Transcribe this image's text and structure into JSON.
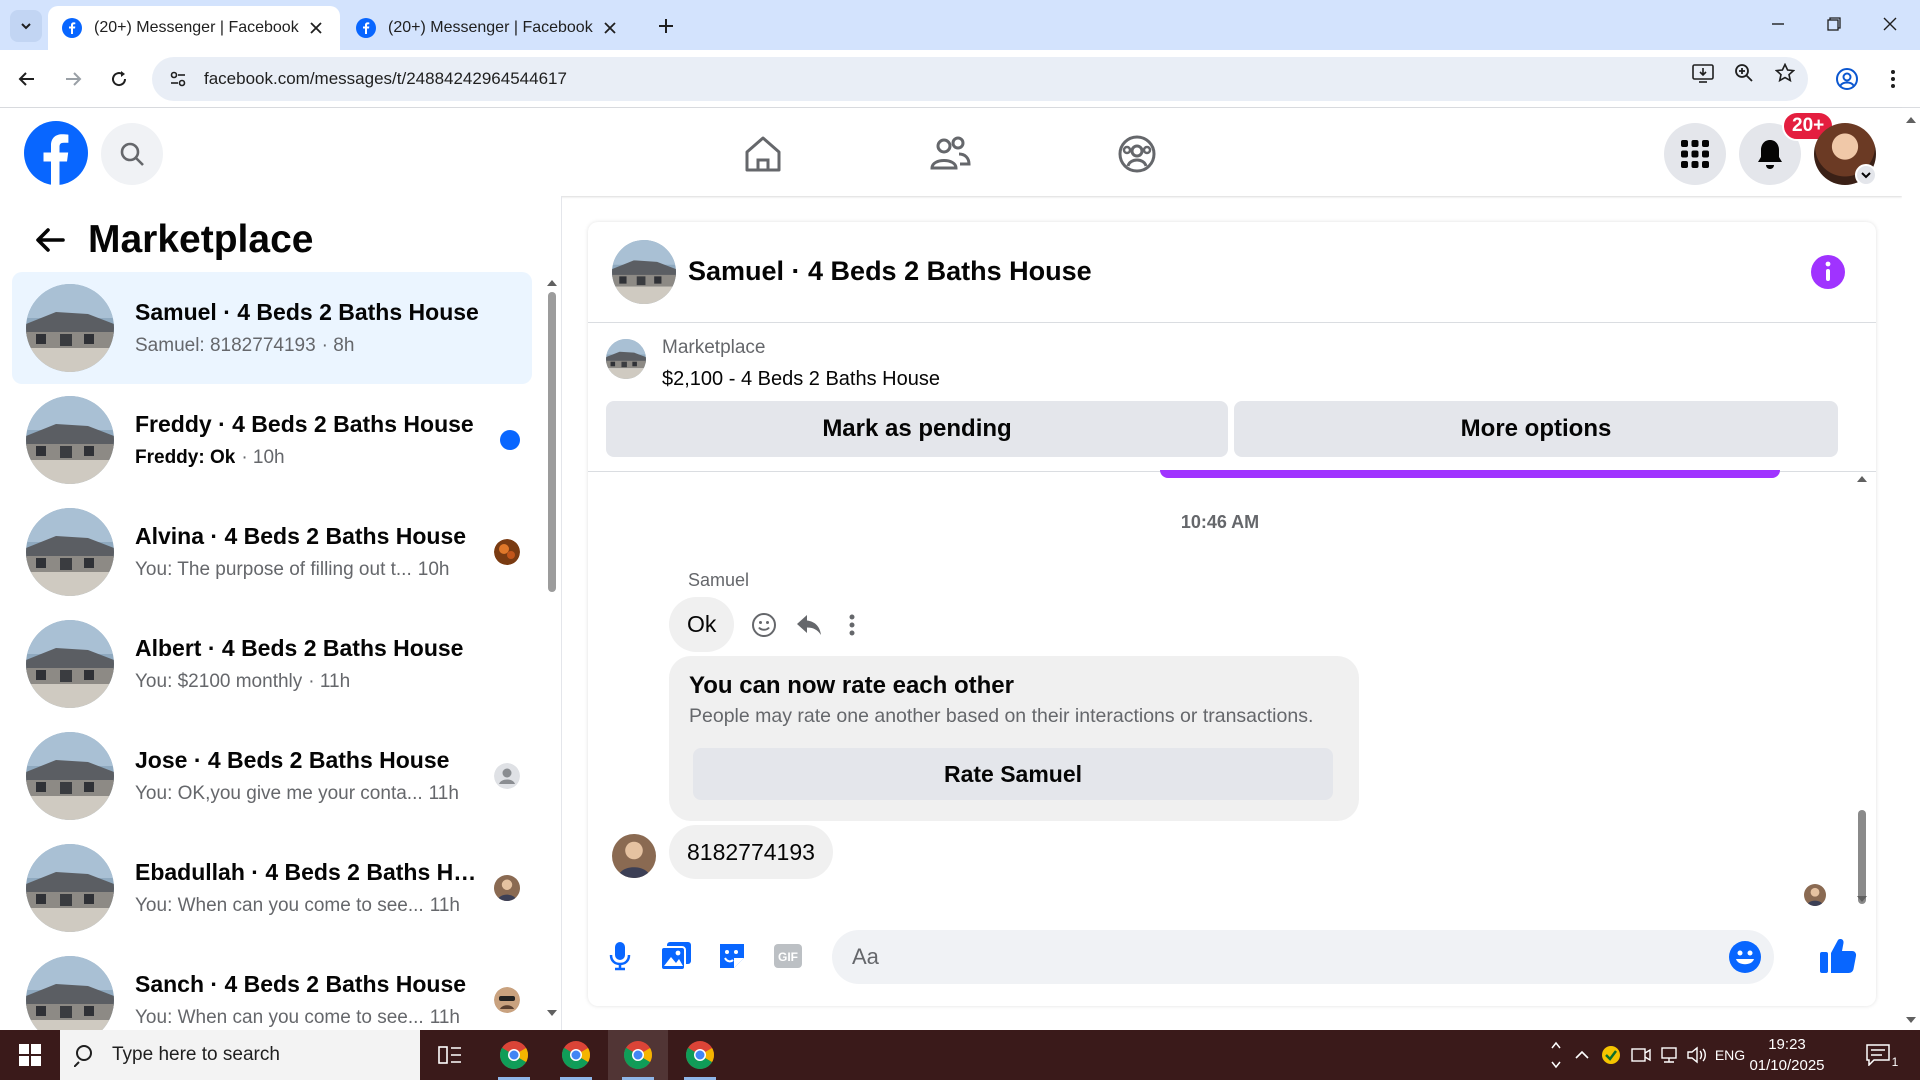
{
  "browser": {
    "tabs": [
      {
        "title": "(20+) Messenger | Facebook",
        "active": true
      },
      {
        "title": "(20+) Messenger | Facebook",
        "active": false
      }
    ],
    "url": "facebook.com/messages/t/24884242964544617"
  },
  "header": {
    "notification_badge": "20+"
  },
  "sidebar": {
    "title": "Marketplace",
    "conversations": [
      {
        "name": "Samuel · 4 Beds 2 Baths House",
        "preview": "Samuel: 8182774193",
        "time": "· 8h",
        "selected": true,
        "unread": false,
        "indicator": "none"
      },
      {
        "name": "Freddy · 4 Beds 2 Baths House",
        "preview": "Freddy: Ok",
        "time": "· 10h",
        "selected": false,
        "unread": true,
        "indicator": "unread-dot"
      },
      {
        "name": "Alvina · 4 Beds 2 Baths House",
        "preview": "You: The purpose of filling out t...",
        "time": "10h",
        "selected": false,
        "unread": false,
        "indicator": "avatar"
      },
      {
        "name": "Albert · 4 Beds 2 Baths House",
        "preview": "You: $2100 monthly",
        "time": "· 11h",
        "selected": false,
        "unread": false,
        "indicator": "none"
      },
      {
        "name": "Jose · 4 Beds 2 Baths House",
        "preview": "You: OK,you give me your conta...",
        "time": "11h",
        "selected": false,
        "unread": false,
        "indicator": "default-avatar"
      },
      {
        "name": "Ebadullah · 4 Beds 2 Baths Ho...",
        "preview": "You: When can you come to see...",
        "time": "11h",
        "selected": false,
        "unread": false,
        "indicator": "avatar"
      },
      {
        "name": "Sanch · 4 Beds 2 Baths House",
        "preview": "You: When can you come to see...",
        "time": "11h",
        "selected": false,
        "unread": false,
        "indicator": "avatar"
      }
    ]
  },
  "chat": {
    "title": "Samuel · 4 Beds 2 Baths House",
    "listing": {
      "label": "Marketplace",
      "price_title": "$2,100 - 4 Beds 2 Baths House",
      "mark_pending_label": "Mark as pending",
      "more_options_label": "More options"
    },
    "timestamp": "10:46 AM",
    "sender_name": "Samuel",
    "messages": [
      {
        "text": "Ok"
      },
      {
        "text": "8182774193"
      }
    ],
    "rating_card": {
      "title": "You can now rate each other",
      "subtitle": "People may rate one another based on their interactions or transactions.",
      "button_label": "Rate Samuel"
    },
    "composer_placeholder": "Aa"
  },
  "taskbar": {
    "search_placeholder": "Type here to search",
    "language": "ENG",
    "time": "19:23",
    "date": "01/10/2025",
    "notification_count": "1"
  },
  "colors": {
    "facebook_blue": "#0866ff",
    "messenger_purple": "#a033ff",
    "notification_red": "#e41e3f",
    "selected_bg": "#ebf5ff"
  }
}
